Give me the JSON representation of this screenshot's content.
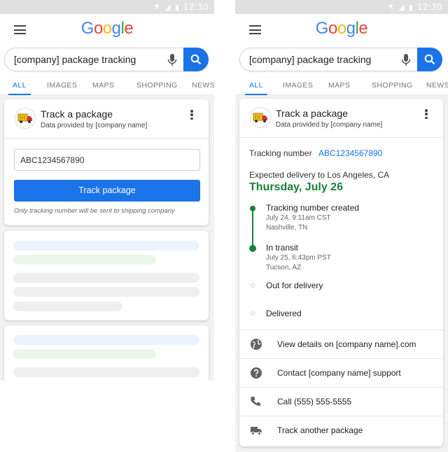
{
  "status_bar": {
    "time": "12:30"
  },
  "logo": {
    "letters": [
      "G",
      "o",
      "o",
      "g",
      "l",
      "e"
    ],
    "colors": [
      "#4285F4",
      "#EA4335",
      "#FBBC05",
      "#4285F4",
      "#34A853",
      "#EA4335"
    ]
  },
  "search": {
    "query": "[company] package tracking"
  },
  "tabs": [
    "ALL",
    "IMAGES",
    "MAPS",
    "SHOPPING",
    "NEWS"
  ],
  "card": {
    "title": "Track a package",
    "subtitle": "Data provided by [company name]",
    "input_value": "ABC1234567890",
    "button_label": "Track package",
    "note": "Only tracking number will be sent to shipping company"
  },
  "result": {
    "tracking_label": "Tracking number",
    "tracking_number": "ABC1234567890",
    "expected_label": "Expected delivery to Los Angeles, CA",
    "expected_date": "Thursday, July 26",
    "events": [
      {
        "title": "Tracking number created",
        "time": "July 24, 9:11am CST",
        "place": "Nashville, TN",
        "done": true
      },
      {
        "title": "In transit",
        "time": "July 25, 6:43pm PST",
        "place": "Tucson, AZ",
        "done": true
      },
      {
        "title": "Out for delivery",
        "time": "",
        "place": "",
        "done": false
      },
      {
        "title": "Delivered",
        "time": "",
        "place": "",
        "done": false
      }
    ],
    "actions": [
      {
        "icon": "globe-icon",
        "label": "View details on [company name].com"
      },
      {
        "icon": "help-icon",
        "label": "Contact [company name] support"
      },
      {
        "icon": "phone-icon",
        "label": "Call (555) 555-5555"
      },
      {
        "icon": "truck-icon",
        "label": "Track another package"
      }
    ]
  },
  "colors": {
    "accent": "#1a73e8",
    "success": "#188038",
    "statusbar": "#e0e0e0"
  }
}
